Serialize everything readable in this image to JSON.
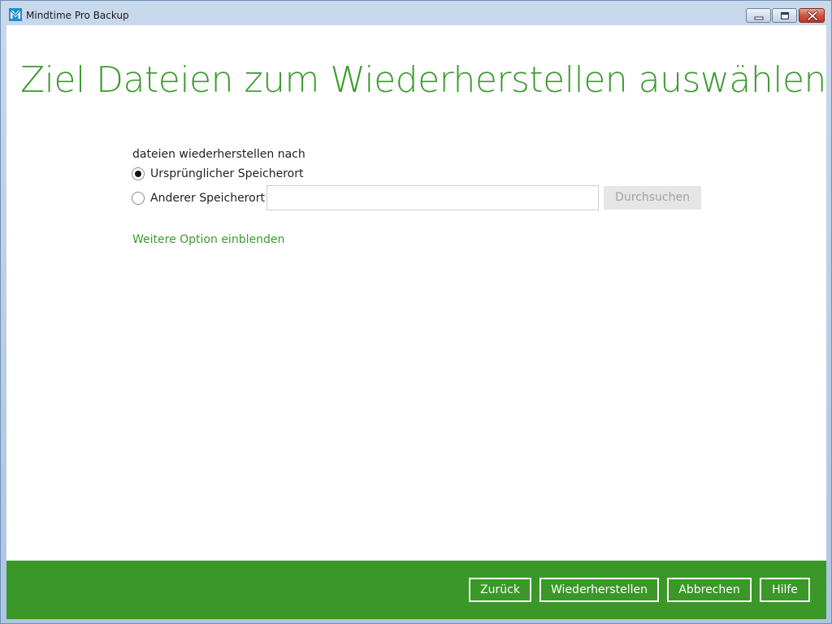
{
  "window": {
    "title": "Mindtime Pro Backup",
    "icon": "mindtime-logo-icon",
    "controls": [
      "minimize-icon",
      "maximize-icon",
      "close-icon"
    ]
  },
  "page": {
    "heading": "Ziel Dateien zum Wiederherstellen auswählen"
  },
  "restore": {
    "section_label": "dateien wiederherstellen nach",
    "options": [
      {
        "label": "Ursprünglicher Speicherort",
        "selected": true
      },
      {
        "label": "Anderer Speicherort",
        "selected": false
      }
    ],
    "path_input": {
      "value": "",
      "placeholder": ""
    },
    "browse_label": "Durchsuchen",
    "more_options_link": "Weitere Option einblenden"
  },
  "footer": {
    "back_label": "Zurück",
    "restore_label": "Wiederherstellen",
    "cancel_label": "Abbrechen",
    "help_label": "Hilfe"
  },
  "colors": {
    "accent_green": "#3b9a2e",
    "footer_green": "#3a9728",
    "disabled_button_bg": "#e5e5e5",
    "disabled_button_text": "#a3a3a3"
  }
}
